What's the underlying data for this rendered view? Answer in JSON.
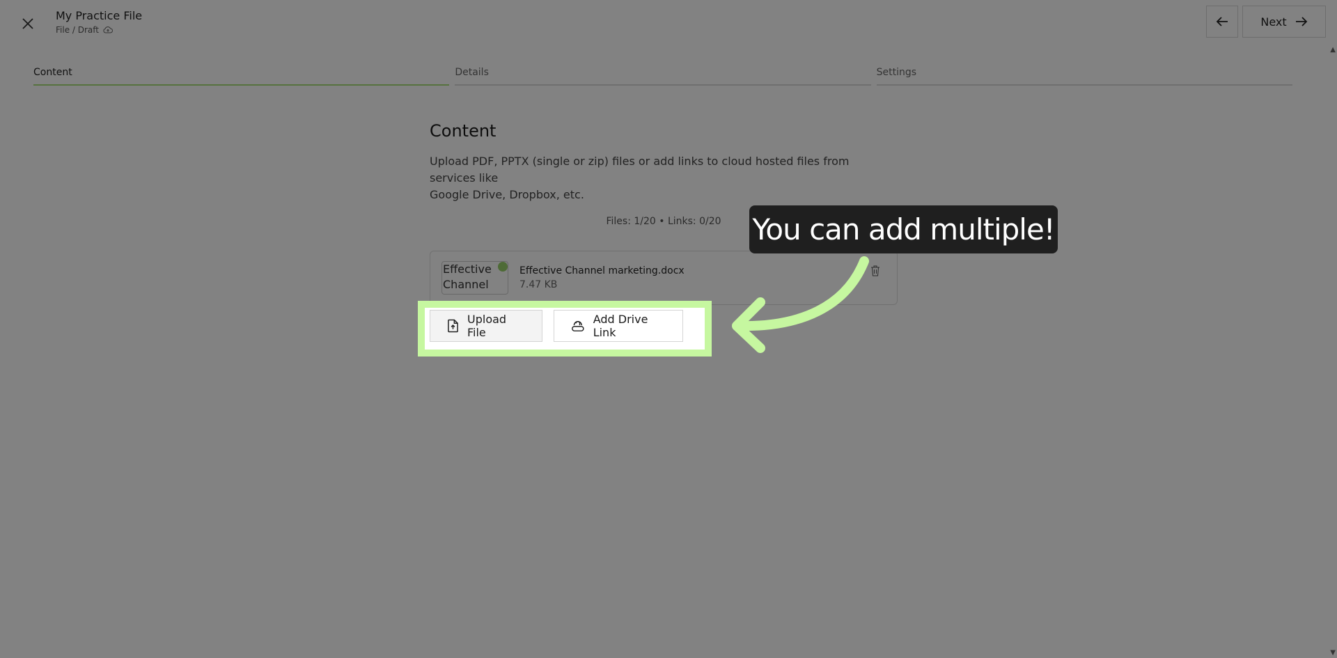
{
  "header": {
    "title": "My Practice File",
    "path": "File / Draft",
    "next_label": "Next",
    "icons": {
      "close": "close-icon",
      "cloud": "cloud-upload-icon",
      "back": "arrow-left-icon",
      "next": "arrow-right-icon"
    }
  },
  "tabs": [
    {
      "label": "Content",
      "active": true
    },
    {
      "label": "Details",
      "active": false
    },
    {
      "label": "Settings",
      "active": false
    }
  ],
  "content": {
    "heading": "Content",
    "description_line1": "Upload PDF, PPTX (single or zip) files or add links to cloud hosted files from services like",
    "description_line2": "Google Drive, Dropbox, etc.",
    "counts": "Files: 1/20 • Links: 0/20",
    "file": {
      "thumb_alt_line1": "Effective",
      "thumb_alt_line2": "Channel",
      "name": "Effective Channel marketing.docx",
      "size": "7.47 KB"
    },
    "upload_label": "Upload File",
    "drive_label": "Add Drive Link"
  },
  "tooltip": {
    "text": "You can add multiple!"
  },
  "colors": {
    "highlight": "#c6f7a0",
    "active_tab_underline": "#a9e07a",
    "callout_bg": "#1f1f1f"
  }
}
